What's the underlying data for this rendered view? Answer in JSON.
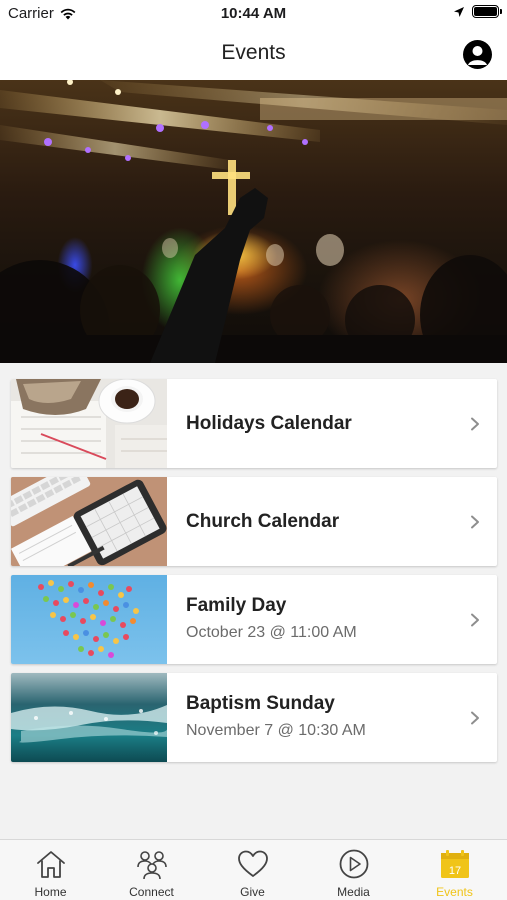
{
  "status_bar": {
    "carrier": "Carrier",
    "time": "10:44 AM"
  },
  "header": {
    "title": "Events"
  },
  "events": [
    {
      "title": "Holidays Calendar",
      "subtitle": ""
    },
    {
      "title": "Church Calendar",
      "subtitle": ""
    },
    {
      "title": "Family Day",
      "subtitle": "October 23 @ 11:00 AM"
    },
    {
      "title": "Baptism Sunday",
      "subtitle": "November 7 @ 10:30 AM"
    }
  ],
  "tab_bar": {
    "tabs": [
      {
        "label": "Home",
        "icon": "home-icon"
      },
      {
        "label": "Connect",
        "icon": "people-icon"
      },
      {
        "label": "Give",
        "icon": "heart-icon"
      },
      {
        "label": "Media",
        "icon": "play-icon"
      },
      {
        "label": "Events",
        "icon": "calendar-icon",
        "calendar_day": "17"
      }
    ],
    "active_tab": "Events"
  },
  "colors": {
    "accent": "#f0c419",
    "background": "#f2f2f2",
    "card": "#ffffff"
  }
}
